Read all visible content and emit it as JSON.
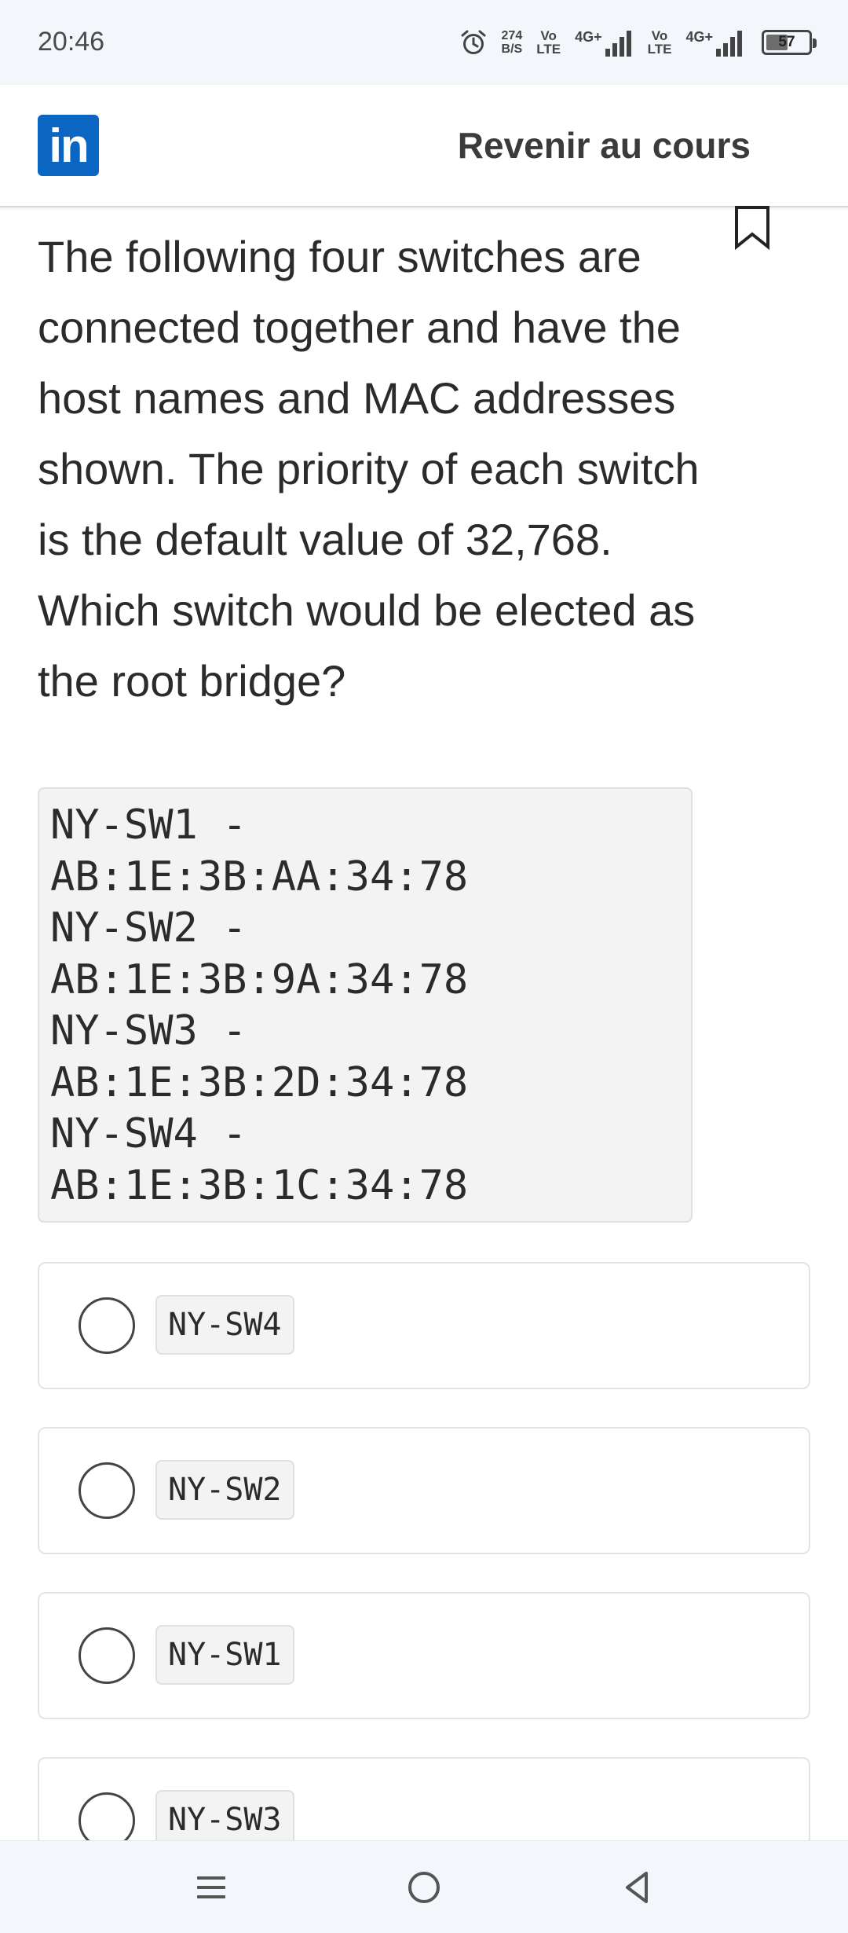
{
  "status_bar": {
    "time": "20:46",
    "net_speed_value": "274",
    "net_speed_unit": "B/S",
    "sim1_volte_top": "Vo",
    "sim1_volte_bottom": "LTE",
    "sim1_network": "4G+",
    "sim2_volte_top": "Vo",
    "sim2_volte_bottom": "LTE",
    "sim2_network": "4G+",
    "battery_level": "57"
  },
  "header": {
    "logo_text": "in",
    "back_link": "Revenir au cours"
  },
  "question": {
    "text": "The following four switches are connected together and have the host names and MAC addresses shown. The priority of each switch is the default value of 32,768. Which switch would be elected as the root bridge?",
    "code_lines": [
      "NY-SW1 -",
      "AB:1E:3B:AA:34:78",
      "NY-SW2 -",
      "AB:1E:3B:9A:34:78",
      "NY-SW3 -",
      "AB:1E:3B:2D:34:78",
      "NY-SW4 -",
      "AB:1E:3B:1C:34:78"
    ]
  },
  "options": [
    {
      "label": "NY-SW4"
    },
    {
      "label": "NY-SW2"
    },
    {
      "label": "NY-SW1"
    },
    {
      "label": "NY-SW3"
    }
  ],
  "icons": {
    "bookmark": "bookmark-icon",
    "alarm": "alarm-icon",
    "menu": "menu-icon",
    "home": "home-icon",
    "back": "back-icon"
  },
  "colors": {
    "brand": "#0a66c2",
    "status_bg": "#f3f6fb"
  }
}
